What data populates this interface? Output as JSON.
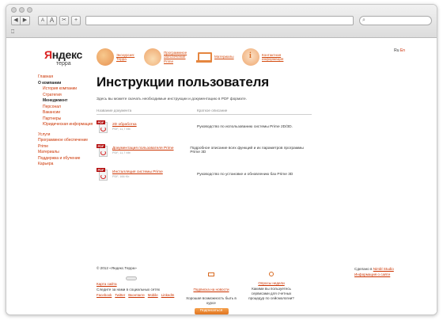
{
  "browser": {
    "nav_back": "◀",
    "nav_forward": "▶",
    "font_small": "A",
    "font_large": "A",
    "tools": "✂",
    "new_tab": "+",
    "url": "",
    "search_placeholder": "",
    "bookmarks_icon": "book-icon"
  },
  "header": {
    "logo_prefix": "Я",
    "logo_rest": "ндекс",
    "logo_sub": "терра",
    "nav": [
      {
        "label": "Экскурсия: Терра",
        "icon": "coins-icon"
      },
      {
        "label": "Программное обеспечение Prime",
        "icon": "mountain-icon"
      },
      {
        "label": "Материалы",
        "icon": "laptop-icon"
      },
      {
        "label": "Контактная информация",
        "icon": "contact-icon"
      }
    ],
    "lang_ru": "Ru",
    "lang_en": "En"
  },
  "sidebar": {
    "items": [
      {
        "label": "Главная",
        "level": 0,
        "current": false
      },
      {
        "label": "О компании",
        "level": 0,
        "current": true
      },
      {
        "label": "История компании",
        "level": 1,
        "current": false
      },
      {
        "label": "Стратегия",
        "level": 1,
        "current": false
      },
      {
        "label": "Менеджмент",
        "level": 1,
        "current": true
      },
      {
        "label": "Персонал",
        "level": 1,
        "current": false
      },
      {
        "label": "Вакансии",
        "level": 1,
        "current": false
      },
      {
        "label": "Партнеры",
        "level": 1,
        "current": false
      },
      {
        "label": "Юридическая информация",
        "level": 1,
        "current": false
      },
      {
        "label": "Услуги",
        "level": 0,
        "current": false
      },
      {
        "label": "Программное обеспечение Prime",
        "level": 0,
        "current": false
      },
      {
        "label": "Материалы",
        "level": 0,
        "current": false
      },
      {
        "label": "Поддержка и обучение",
        "level": 0,
        "current": false
      },
      {
        "label": "Карьера",
        "level": 0,
        "current": false
      }
    ]
  },
  "main": {
    "title": "Инструкции пользователя",
    "intro": "Здесь вы можете скачать необходимые инструкции и документацию в PDF формате.",
    "columns": [
      "Название документа",
      "Краткое описание"
    ],
    "documents": [
      {
        "name": "2D обработка",
        "size": "PDF, 11,7 Mb",
        "description": "Руководство по использованию системы Prime 2D/3D.",
        "icon": "pdf-icon"
      },
      {
        "name": "Документация пользователя Prime",
        "size": "PDF, 11,7 Mb",
        "description": "Подробное описание всех функций и их параметров программы Prime 3D",
        "icon": "pdf-icon"
      },
      {
        "name": "Инсталляция системы Prime",
        "size": "PDF, 166 Kb",
        "description": "Руководство по установке и обновлению бaз Prime 3D",
        "icon": "pdf-icon"
      }
    ]
  },
  "footer": {
    "copyright": "© 2012 «Яндекс.Терра»",
    "sitemap": "Карта сайта",
    "follow": "Следите за нами в социальных сетях",
    "social": [
      "Facebook",
      "Twitter",
      "Вконтакте",
      "Mobile",
      "LinkedIn"
    ],
    "subscribe_title": "Подписка на новости",
    "subscribe_text": "Хорошая возможность быть в курсе",
    "subscribe_button": "Подписаться",
    "poll_title": "Опросы недели",
    "poll_text": "Какими вы пользуетесь сервисами для счетных процедур по сейсмологии?",
    "made_by": "Сделано в",
    "studio": "Nimbl Studio",
    "site_info": "Информация о сайте"
  }
}
